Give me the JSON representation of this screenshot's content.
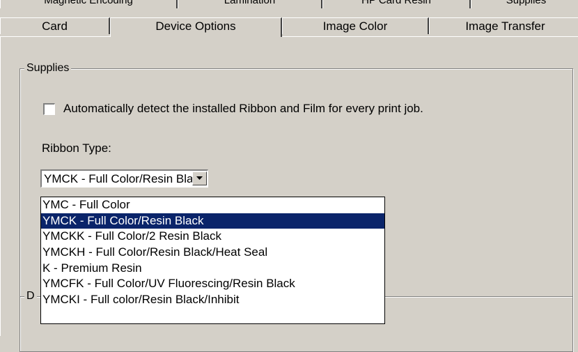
{
  "back_tabs": [
    "Magnetic Encoding",
    "Lamination",
    "HP Card Resin",
    "Supplies"
  ],
  "tabs": [
    {
      "label": "Card",
      "active": false
    },
    {
      "label": "Device Options",
      "active": true
    },
    {
      "label": "Image Color",
      "active": false
    },
    {
      "label": "Image Transfer",
      "active": false
    }
  ],
  "supplies": {
    "legend": "Supplies",
    "auto_detect_label": "Automatically detect the installed Ribbon and Film for every print job.",
    "auto_detect_checked": false,
    "ribbon_type_label": "Ribbon Type:",
    "ribbon_selected": "YMCK - Full Color/Resin Black",
    "ribbon_options": [
      "YMC - Full Color",
      "YMCK - Full Color/Resin Black",
      "YMCKK - Full Color/2 Resin Black",
      "YMCKH - Full Color/Resin Black/Heat Seal",
      "K - Premium Resin",
      "YMCFK - Full Color/UV Fluorescing/Resin Black",
      "YMCKI - Full color/Resin Black/Inhibit"
    ],
    "selected_index": 1
  },
  "second_group": {
    "legend": "D"
  },
  "colors": {
    "background": "#d4d0c8",
    "selection": "#0a246a"
  },
  "icons": {
    "dropdown_arrow": "chevron-down-icon"
  }
}
